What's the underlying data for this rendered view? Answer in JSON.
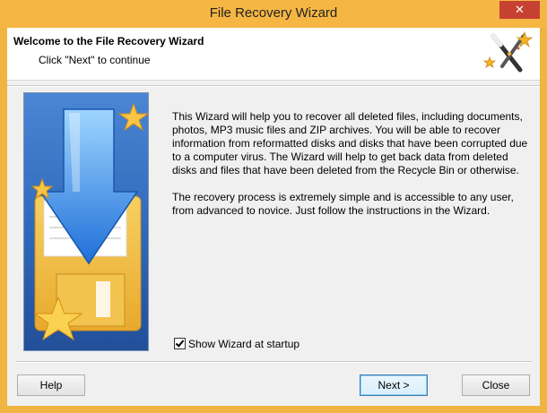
{
  "window": {
    "title": "File Recovery Wizard",
    "close_glyph": "✕"
  },
  "header": {
    "title": "Welcome to the File Recovery Wizard",
    "subtitle": "Click \"Next\" to continue"
  },
  "body": {
    "paragraph1": "This Wizard will help you to recover all deleted files, including documents, photos, MP3 music files and ZIP archives. You will be able to recover information from reformatted disks and disks that have been corrupted due to a computer virus. The Wizard will help to get back data from deleted disks and files that have been deleted from the Recycle Bin or otherwise.",
    "paragraph2": "The recovery process is extremely simple and is accessible to any user, from advanced to novice. Just follow the instructions in the Wizard."
  },
  "startup_checkbox": {
    "label": "Show Wizard at startup",
    "checked": true
  },
  "buttons": {
    "help": "Help",
    "next": "Next >",
    "close": "Close"
  },
  "colors": {
    "frame": "#f5b643",
    "close_button": "#c74133",
    "side_panel": "#2f68b9"
  },
  "icons": [
    "magic-wand-icon",
    "download-arrow-icon",
    "floppy-disk-icon",
    "star-icon"
  ]
}
